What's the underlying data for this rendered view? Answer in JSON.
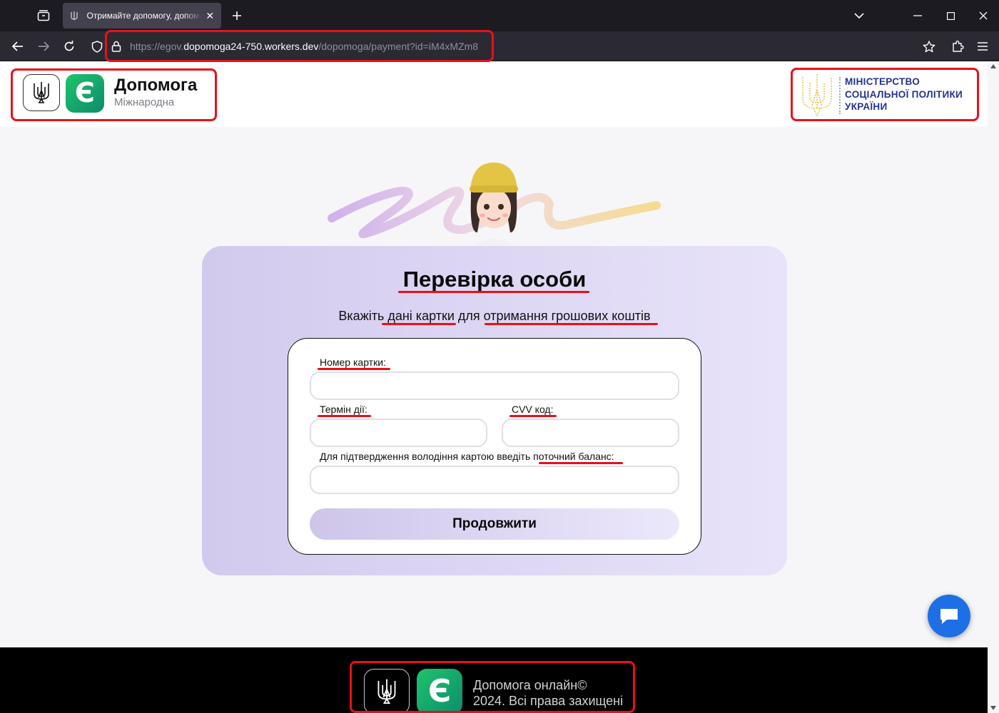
{
  "browser": {
    "tab_title": "Отримайте допомогу, допомога",
    "url_prefix": "https://egov.",
    "url_host": "dopomoga24-750.workers.dev",
    "url_path": "/dopomoga/payment?id=iM4xMZm8"
  },
  "header": {
    "brand_title": "Допомога",
    "brand_subtitle": "Міжнародна",
    "logo_letter": "Є",
    "ministry_line1": "МІНІСТЕРСТВО",
    "ministry_line2": "СОЦІАЛЬНОЇ ПОЛІТИКИ",
    "ministry_line3": "УКРАЇНИ"
  },
  "card": {
    "title": "Перевірка особи",
    "subtitle": "Вкажіть дані картки для отримання грошових коштів"
  },
  "form": {
    "card_number_label": "Номер картки:",
    "card_number_value": "",
    "expiry_label": "Термін дії:",
    "expiry_value": "",
    "cvv_label": "CVV код:",
    "cvv_value": "",
    "balance_label": "Для підтвердження володіння картою введіть поточний баланс:",
    "balance_value": "",
    "submit_label": "Продовжити"
  },
  "footer": {
    "line1": "Допомога онлайн©",
    "line2": "2024. Всі права захищені",
    "logo_letter": "Є"
  },
  "colors": {
    "accent_green": "#1fc46b",
    "card_lavender": "#d2caed",
    "ministry_blue": "#23348f",
    "annotation_red": "#e8101a",
    "chat_blue": "#1e6fe6"
  }
}
